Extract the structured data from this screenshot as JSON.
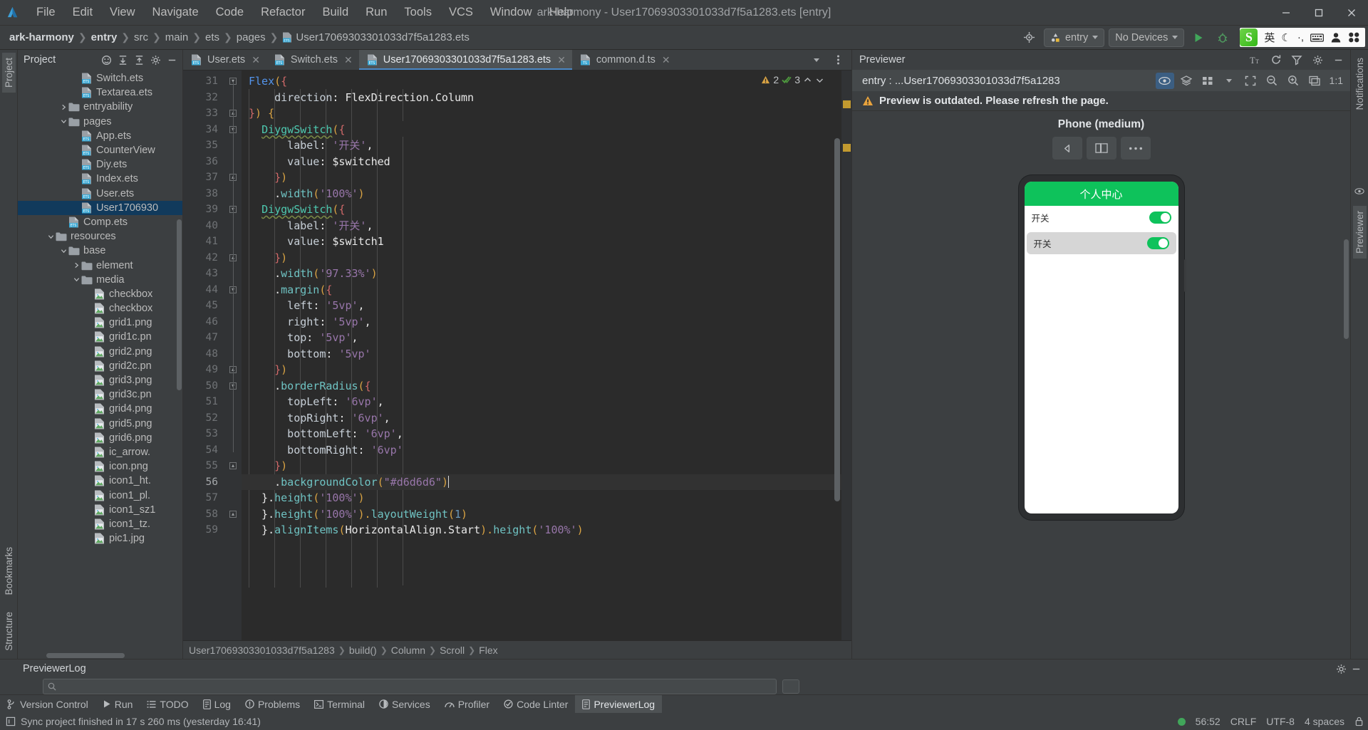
{
  "titlebar": {
    "menus": [
      "File",
      "Edit",
      "View",
      "Navigate",
      "Code",
      "Refactor",
      "Build",
      "Run",
      "Tools",
      "VCS",
      "Window",
      "Help"
    ],
    "window_title": "ark-harmony - User17069303301033d7f5a1283.ets [entry]",
    "minimize": "–",
    "maximize": "□",
    "close": "✕"
  },
  "navbar": {
    "breadcrumb": [
      "ark-harmony",
      "entry",
      "src",
      "main",
      "ets",
      "pages",
      "User17069303301033d7f5a1283.ets"
    ],
    "run_config": "entry",
    "device": "No Devices",
    "ime": {
      "language": "英",
      "moon": "☾",
      "punct": "·,",
      "keyboard": "⌨",
      "user": "👤",
      "apps": "▩"
    },
    "accent": "#4a88c7",
    "run_green": "#41a65a"
  },
  "left_rail": {
    "top": [
      "Project"
    ],
    "bottom": [
      "Bookmarks",
      "Structure"
    ]
  },
  "right_rail": {
    "items": [
      "Notifications",
      "Previewer"
    ]
  },
  "project_panel": {
    "title": "Project",
    "tree": [
      {
        "label": "Switch.ets",
        "indent": 4,
        "icon": "ets-file",
        "twist": "",
        "selected": false
      },
      {
        "label": "Textarea.ets",
        "indent": 4,
        "icon": "ets-file",
        "twist": "",
        "selected": false
      },
      {
        "label": "entryability",
        "indent": 3,
        "icon": "folder",
        "twist": ">",
        "selected": false
      },
      {
        "label": "pages",
        "indent": 3,
        "icon": "folder",
        "twist": "v",
        "selected": false
      },
      {
        "label": "App.ets",
        "indent": 4,
        "icon": "ets-file",
        "twist": "",
        "selected": false
      },
      {
        "label": "CounterView",
        "indent": 4,
        "icon": "ets-file",
        "twist": "",
        "selected": false
      },
      {
        "label": "Diy.ets",
        "indent": 4,
        "icon": "ets-file",
        "twist": "",
        "selected": false
      },
      {
        "label": "Index.ets",
        "indent": 4,
        "icon": "ets-file",
        "twist": "",
        "selected": false
      },
      {
        "label": "User.ets",
        "indent": 4,
        "icon": "ets-file",
        "twist": "",
        "selected": false
      },
      {
        "label": "User1706930",
        "indent": 4,
        "icon": "ets-file",
        "twist": "",
        "selected": true
      },
      {
        "label": "Comp.ets",
        "indent": 3,
        "icon": "ets-file",
        "twist": "",
        "selected": false
      },
      {
        "label": "resources",
        "indent": 2,
        "icon": "folder",
        "twist": "v",
        "selected": false
      },
      {
        "label": "base",
        "indent": 3,
        "icon": "folder",
        "twist": "v",
        "selected": false
      },
      {
        "label": "element",
        "indent": 4,
        "icon": "folder",
        "twist": ">",
        "selected": false
      },
      {
        "label": "media",
        "indent": 4,
        "icon": "folder",
        "twist": "v",
        "selected": false
      },
      {
        "label": "checkbox",
        "indent": 5,
        "icon": "image-file",
        "twist": "",
        "selected": false
      },
      {
        "label": "checkbox",
        "indent": 5,
        "icon": "image-file",
        "twist": "",
        "selected": false
      },
      {
        "label": "grid1.png",
        "indent": 5,
        "icon": "image-file",
        "twist": "",
        "selected": false
      },
      {
        "label": "grid1c.pn",
        "indent": 5,
        "icon": "image-file",
        "twist": "",
        "selected": false
      },
      {
        "label": "grid2.png",
        "indent": 5,
        "icon": "image-file",
        "twist": "",
        "selected": false
      },
      {
        "label": "grid2c.pn",
        "indent": 5,
        "icon": "image-file",
        "twist": "",
        "selected": false
      },
      {
        "label": "grid3.png",
        "indent": 5,
        "icon": "image-file",
        "twist": "",
        "selected": false
      },
      {
        "label": "grid3c.pn",
        "indent": 5,
        "icon": "image-file",
        "twist": "",
        "selected": false
      },
      {
        "label": "grid4.png",
        "indent": 5,
        "icon": "image-file",
        "twist": "",
        "selected": false
      },
      {
        "label": "grid5.png",
        "indent": 5,
        "icon": "image-file",
        "twist": "",
        "selected": false
      },
      {
        "label": "grid6.png",
        "indent": 5,
        "icon": "image-file",
        "twist": "",
        "selected": false
      },
      {
        "label": "ic_arrow.",
        "indent": 5,
        "icon": "image-file",
        "twist": "",
        "selected": false
      },
      {
        "label": "icon.png",
        "indent": 5,
        "icon": "image-file",
        "twist": "",
        "selected": false
      },
      {
        "label": "icon1_ht.",
        "indent": 5,
        "icon": "image-file",
        "twist": "",
        "selected": false
      },
      {
        "label": "icon1_pl.",
        "indent": 5,
        "icon": "image-file",
        "twist": "",
        "selected": false
      },
      {
        "label": "icon1_sz1",
        "indent": 5,
        "icon": "image-file",
        "twist": "",
        "selected": false
      },
      {
        "label": "icon1_tz.",
        "indent": 5,
        "icon": "image-file",
        "twist": "",
        "selected": false
      },
      {
        "label": "pic1.jpg",
        "indent": 5,
        "icon": "image-file",
        "twist": "",
        "selected": false
      }
    ]
  },
  "editor": {
    "tabs": [
      {
        "label": "User.ets",
        "icon": "ets-file",
        "active": false
      },
      {
        "label": "Switch.ets",
        "icon": "ets-file",
        "active": false
      },
      {
        "label": "User17069303301033d7f5a1283.ets",
        "icon": "ets-file",
        "active": true
      },
      {
        "label": "common.d.ts",
        "icon": "ts-file",
        "active": false
      }
    ],
    "inspection": {
      "warnings": "2",
      "checks": "3"
    },
    "first_line": 31,
    "cursor_line": 56,
    "lines": [
      {
        "n": 31,
        "fold": "end-down",
        "tokens": [
          {
            "t": "Flex",
            "c": "fn"
          },
          {
            "t": "(",
            "c": "br1"
          },
          {
            "t": "{",
            "c": "br2"
          }
        ]
      },
      {
        "n": 32,
        "fold": "",
        "tokens": [
          {
            "t": "    direction",
            "c": "prop"
          },
          {
            "t": ": ",
            "c": "var"
          },
          {
            "t": "FlexDirection",
            "c": "var"
          },
          {
            "t": ".Column",
            "c": "var"
          }
        ]
      },
      {
        "n": 33,
        "fold": "start-up",
        "tokens": [
          {
            "t": "}",
            "c": "br2"
          },
          {
            "t": ") ",
            "c": "br1"
          },
          {
            "t": "{",
            "c": "br1"
          }
        ]
      },
      {
        "n": 34,
        "fold": "end-down",
        "tokens": [
          {
            "t": "  ",
            "c": "var"
          },
          {
            "t": "DiygwSwitch",
            "c": "comp squig"
          },
          {
            "t": "(",
            "c": "br1"
          },
          {
            "t": "{",
            "c": "br2"
          }
        ]
      },
      {
        "n": 35,
        "fold": "",
        "tokens": [
          {
            "t": "      label",
            "c": "prop"
          },
          {
            "t": ": ",
            "c": "var"
          },
          {
            "t": "'开关'",
            "c": "str"
          },
          {
            "t": ",",
            "c": "var"
          }
        ]
      },
      {
        "n": 36,
        "fold": "",
        "tokens": [
          {
            "t": "      value",
            "c": "prop"
          },
          {
            "t": ": ",
            "c": "var"
          },
          {
            "t": "$switched",
            "c": "var"
          }
        ]
      },
      {
        "n": 37,
        "fold": "start-up",
        "tokens": [
          {
            "t": "    ",
            "c": "var"
          },
          {
            "t": "}",
            "c": "br2"
          },
          {
            "t": ")",
            "c": "br1"
          }
        ]
      },
      {
        "n": 38,
        "fold": "",
        "tokens": [
          {
            "t": "    .",
            "c": "var"
          },
          {
            "t": "width",
            "c": "method"
          },
          {
            "t": "(",
            "c": "br1"
          },
          {
            "t": "'100%'",
            "c": "str"
          },
          {
            "t": ")",
            "c": "br1"
          }
        ]
      },
      {
        "n": 39,
        "fold": "end-down",
        "tokens": [
          {
            "t": "  ",
            "c": "var"
          },
          {
            "t": "DiygwSwitch",
            "c": "comp squig"
          },
          {
            "t": "(",
            "c": "br1"
          },
          {
            "t": "{",
            "c": "br2"
          }
        ]
      },
      {
        "n": 40,
        "fold": "",
        "tokens": [
          {
            "t": "      label",
            "c": "prop"
          },
          {
            "t": ": ",
            "c": "var"
          },
          {
            "t": "'开关'",
            "c": "str"
          },
          {
            "t": ",",
            "c": "var"
          }
        ]
      },
      {
        "n": 41,
        "fold": "",
        "tokens": [
          {
            "t": "      value",
            "c": "prop"
          },
          {
            "t": ": ",
            "c": "var"
          },
          {
            "t": "$switch1",
            "c": "var"
          }
        ]
      },
      {
        "n": 42,
        "fold": "start-up",
        "tokens": [
          {
            "t": "    ",
            "c": "var"
          },
          {
            "t": "}",
            "c": "br2"
          },
          {
            "t": ")",
            "c": "br1"
          }
        ]
      },
      {
        "n": 43,
        "fold": "",
        "tokens": [
          {
            "t": "    .",
            "c": "var"
          },
          {
            "t": "width",
            "c": "method"
          },
          {
            "t": "(",
            "c": "br1"
          },
          {
            "t": "'97.33%'",
            "c": "str"
          },
          {
            "t": ")",
            "c": "br1"
          }
        ]
      },
      {
        "n": 44,
        "fold": "end-down",
        "tokens": [
          {
            "t": "    .",
            "c": "var"
          },
          {
            "t": "margin",
            "c": "method"
          },
          {
            "t": "(",
            "c": "br1"
          },
          {
            "t": "{",
            "c": "br2"
          }
        ]
      },
      {
        "n": 45,
        "fold": "",
        "tokens": [
          {
            "t": "      left",
            "c": "prop"
          },
          {
            "t": ": ",
            "c": "var"
          },
          {
            "t": "'5vp'",
            "c": "str"
          },
          {
            "t": ",",
            "c": "var"
          }
        ]
      },
      {
        "n": 46,
        "fold": "",
        "tokens": [
          {
            "t": "      right",
            "c": "prop"
          },
          {
            "t": ": ",
            "c": "var"
          },
          {
            "t": "'5vp'",
            "c": "str"
          },
          {
            "t": ",",
            "c": "var"
          }
        ]
      },
      {
        "n": 47,
        "fold": "",
        "tokens": [
          {
            "t": "      top",
            "c": "prop"
          },
          {
            "t": ": ",
            "c": "var"
          },
          {
            "t": "'5vp'",
            "c": "str"
          },
          {
            "t": ",",
            "c": "var"
          }
        ]
      },
      {
        "n": 48,
        "fold": "",
        "tokens": [
          {
            "t": "      bottom",
            "c": "prop"
          },
          {
            "t": ": ",
            "c": "var"
          },
          {
            "t": "'5vp'",
            "c": "str"
          }
        ]
      },
      {
        "n": 49,
        "fold": "start-up",
        "tokens": [
          {
            "t": "    ",
            "c": "var"
          },
          {
            "t": "}",
            "c": "br2"
          },
          {
            "t": ")",
            "c": "br1"
          }
        ]
      },
      {
        "n": 50,
        "fold": "end-down",
        "tokens": [
          {
            "t": "    .",
            "c": "var"
          },
          {
            "t": "borderRadius",
            "c": "method"
          },
          {
            "t": "(",
            "c": "br1"
          },
          {
            "t": "{",
            "c": "br2"
          }
        ]
      },
      {
        "n": 51,
        "fold": "",
        "tokens": [
          {
            "t": "      topLeft",
            "c": "prop"
          },
          {
            "t": ": ",
            "c": "var"
          },
          {
            "t": "'6vp'",
            "c": "str"
          },
          {
            "t": ",",
            "c": "var"
          }
        ]
      },
      {
        "n": 52,
        "fold": "",
        "tokens": [
          {
            "t": "      topRight",
            "c": "prop"
          },
          {
            "t": ": ",
            "c": "var"
          },
          {
            "t": "'6vp'",
            "c": "str"
          },
          {
            "t": ",",
            "c": "var"
          }
        ]
      },
      {
        "n": 53,
        "fold": "",
        "tokens": [
          {
            "t": "      bottomLeft",
            "c": "prop"
          },
          {
            "t": ": ",
            "c": "var"
          },
          {
            "t": "'6vp'",
            "c": "str"
          },
          {
            "t": ",",
            "c": "var"
          }
        ]
      },
      {
        "n": 54,
        "fold": "",
        "tokens": [
          {
            "t": "      bottomRight",
            "c": "prop"
          },
          {
            "t": ": ",
            "c": "var"
          },
          {
            "t": "'6vp'",
            "c": "str"
          }
        ]
      },
      {
        "n": 55,
        "fold": "start-up",
        "tokens": [
          {
            "t": "    ",
            "c": "var"
          },
          {
            "t": "}",
            "c": "br2"
          },
          {
            "t": ")",
            "c": "br1"
          }
        ]
      },
      {
        "n": 56,
        "fold": "",
        "cursor": true,
        "tokens": [
          {
            "t": "    .",
            "c": "var"
          },
          {
            "t": "backgroundColor",
            "c": "method"
          },
          {
            "t": "(",
            "c": "br1"
          },
          {
            "t": "\"#d6d6d6\"",
            "c": "str"
          },
          {
            "t": ")",
            "c": "br1"
          }
        ]
      },
      {
        "n": 57,
        "fold": "",
        "tokens": [
          {
            "t": "  }.",
            "c": "var"
          },
          {
            "t": "height",
            "c": "method"
          },
          {
            "t": "(",
            "c": "br1"
          },
          {
            "t": "'100%'",
            "c": "str"
          },
          {
            "t": ")",
            "c": "br1"
          }
        ]
      },
      {
        "n": 58,
        "fold": "start-up",
        "tokens": [
          {
            "t": "  }.",
            "c": "var"
          },
          {
            "t": "height",
            "c": "method"
          },
          {
            "t": "(",
            "c": "br1"
          },
          {
            "t": "'100%'",
            "c": "str"
          },
          {
            "t": ").",
            "c": "br1"
          },
          {
            "t": "layoutWeight",
            "c": "method"
          },
          {
            "t": "(",
            "c": "br1"
          },
          {
            "t": "1",
            "c": "num"
          },
          {
            "t": ")",
            "c": "br1"
          }
        ]
      },
      {
        "n": 59,
        "fold": "",
        "tokens": [
          {
            "t": "  }.",
            "c": "var"
          },
          {
            "t": "alignItems",
            "c": "method"
          },
          {
            "t": "(",
            "c": "br1"
          },
          {
            "t": "HorizontalAlign",
            "c": "var"
          },
          {
            "t": ".Start",
            "c": "var"
          },
          {
            "t": ").",
            "c": "br1"
          },
          {
            "t": "height",
            "c": "method"
          },
          {
            "t": "(",
            "c": "br1"
          },
          {
            "t": "'100%'",
            "c": "str"
          },
          {
            "t": ")",
            "c": "br1"
          }
        ]
      }
    ],
    "status_breadcrumb": [
      "User17069303301033d7f5a1283",
      "build()",
      "Column",
      "Scroll",
      "Flex"
    ]
  },
  "previewer": {
    "title": "Previewer",
    "path": "entry : ...User17069303301033d7f5a1283",
    "warning": "Preview is outdated. Please refresh the page.",
    "device_name": "Phone (medium)",
    "device_buttons": [
      "rotate",
      "fold",
      "more"
    ],
    "zoom_label": "1:1",
    "app_preview": {
      "title": "个人中心",
      "rows": [
        {
          "label": "开关",
          "switch_on": true,
          "style": "plain"
        },
        {
          "label": "开关",
          "switch_on": true,
          "style": "card"
        }
      ],
      "title_bg": "#0ec25b",
      "card_bg": "#d6d6d6"
    }
  },
  "previewer_log": {
    "title": "PreviewerLog",
    "search_placeholder": ""
  },
  "tool_window_bar": [
    {
      "label": "Version Control",
      "icon": "branch-icon",
      "active": false
    },
    {
      "label": "Run",
      "icon": "play-icon",
      "active": false
    },
    {
      "label": "TODO",
      "icon": "list-icon",
      "active": false
    },
    {
      "label": "Log",
      "icon": "log-icon",
      "active": false
    },
    {
      "label": "Problems",
      "icon": "problems-icon",
      "active": false
    },
    {
      "label": "Terminal",
      "icon": "terminal-icon",
      "active": false
    },
    {
      "label": "Services",
      "icon": "services-icon",
      "active": false
    },
    {
      "label": "Profiler",
      "icon": "profiler-icon",
      "active": false
    },
    {
      "label": "Code Linter",
      "icon": "linter-icon",
      "active": false
    },
    {
      "label": "PreviewerLog",
      "icon": "log-icon",
      "active": true
    }
  ],
  "statusbar": {
    "message": "Sync project finished in 17 s 260 ms (yesterday 16:41)",
    "position": "56:52",
    "line_sep": "CRLF",
    "encoding": "UTF-8",
    "indent": "4 spaces"
  }
}
